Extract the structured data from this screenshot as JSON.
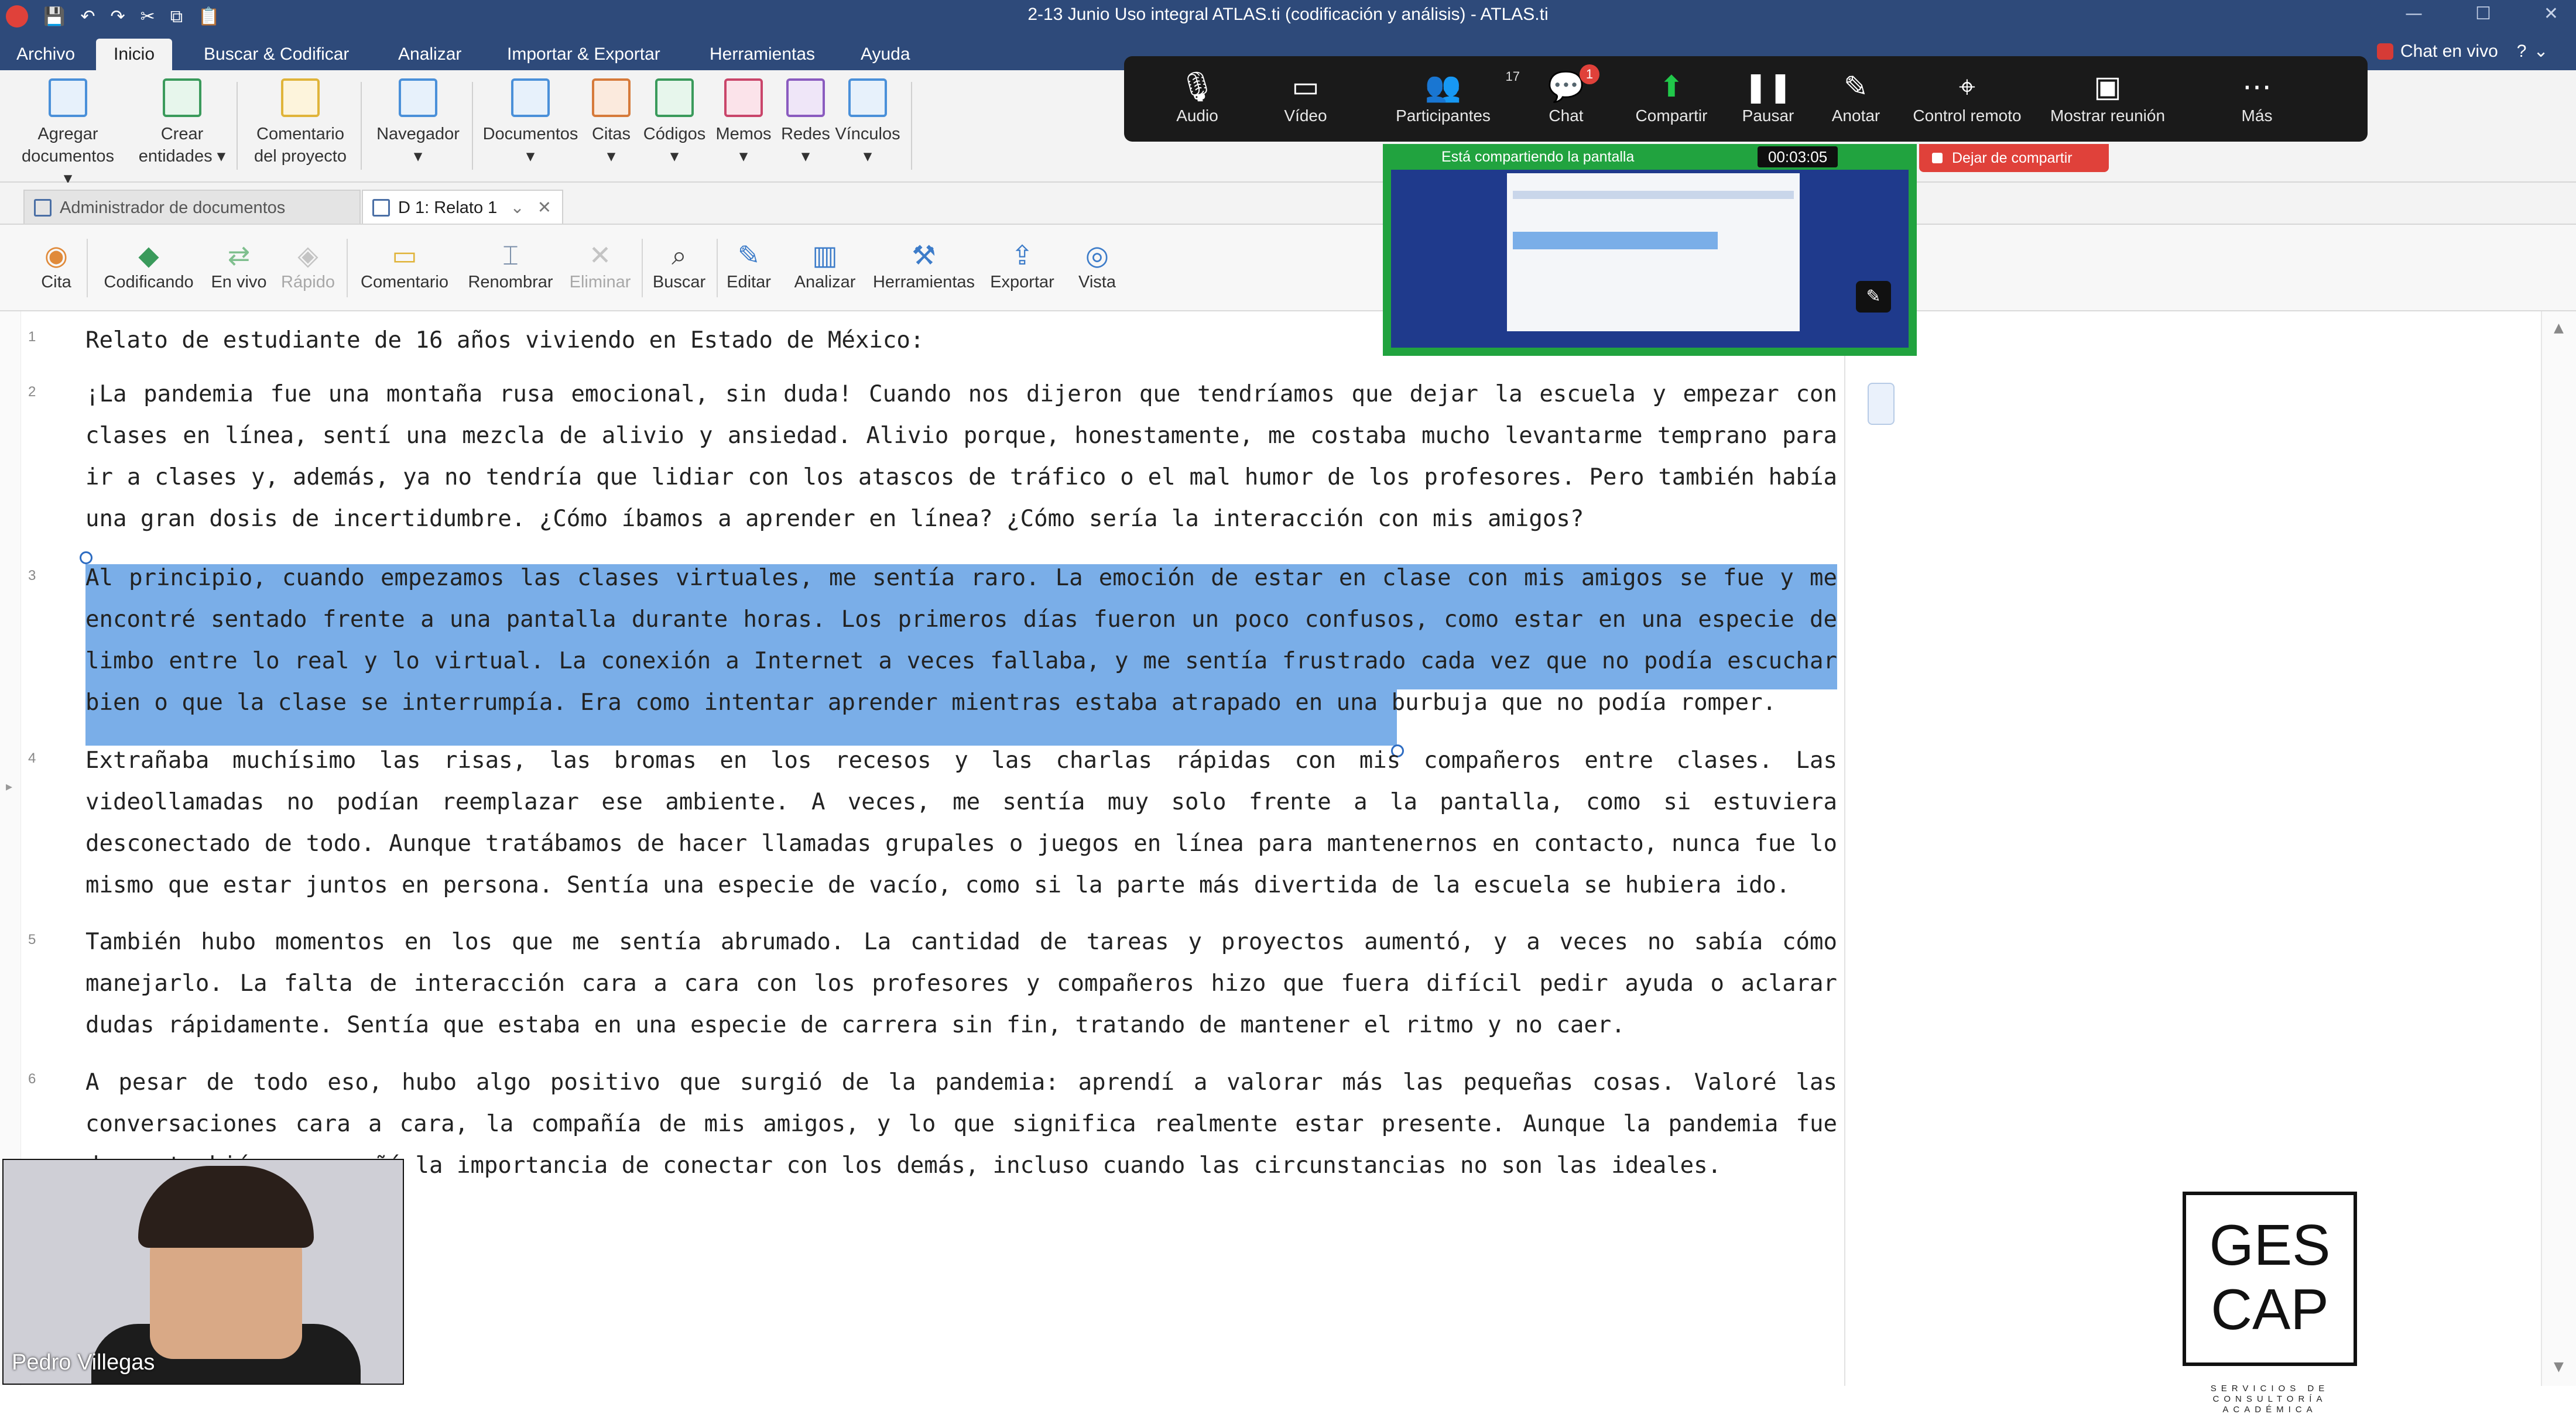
{
  "window": {
    "title": "2-13 Junio Uso integral ATLAS.ti (codificación y análisis) - ATLAS.ti"
  },
  "menu": {
    "tabs": [
      "Archivo",
      "Inicio",
      "Buscar & Codificar",
      "Analizar",
      "Importar & Exportar",
      "Herramientas",
      "Ayuda"
    ],
    "chat_live": "Chat en vivo"
  },
  "ribbon": {
    "buttons": [
      {
        "label1": "Agregar",
        "label2": "documentos ▾"
      },
      {
        "label1": "Crear",
        "label2": "entidades ▾"
      },
      {
        "label1": "Comentario",
        "label2": "del proyecto"
      },
      {
        "label1": "Navegador",
        "label2": "▾"
      },
      {
        "label1": "Documentos",
        "label2": "▾"
      },
      {
        "label1": "Citas",
        "label2": "▾"
      },
      {
        "label1": "Códigos",
        "label2": "▾"
      },
      {
        "label1": "Memos",
        "label2": "▾"
      },
      {
        "label1": "Redes",
        "label2": "▾"
      },
      {
        "label1": "Vínculos",
        "label2": "▾"
      }
    ]
  },
  "doc_tabs": {
    "manager": "Administrador de documentos",
    "active": "D 1: Relato 1"
  },
  "doc_toolbar": {
    "buttons": [
      "Cita",
      "Codificando",
      "En vivo",
      "Rápido",
      "Comentario",
      "Renombrar",
      "Eliminar",
      "Buscar",
      "Editar",
      "Analizar",
      "Herramientas",
      "Exportar",
      "Vista"
    ]
  },
  "zoom": {
    "buttons": [
      "Audio",
      "Vídeo",
      "Participantes",
      "Chat",
      "Compartir",
      "Pausar",
      "Anotar",
      "Control remoto",
      "Mostrar reunión",
      "Más"
    ],
    "participants_count": "17",
    "chat_badge": "1",
    "sharing_text": "Está compartiendo la pantalla",
    "timer": "00:03:05",
    "stop_sharing": "Dejar de compartir"
  },
  "document": {
    "paragraphs": [
      {
        "num": "1",
        "text": "Relato de estudiante de 16 años viviendo en Estado de México:"
      },
      {
        "num": "2",
        "text": "¡La pandemia fue una montaña rusa emocional, sin duda! Cuando nos dijeron que tendríamos que dejar la escuela y empezar con clases en línea, sentí una mezcla de alivio y ansiedad. Alivio porque, honestamente, me costaba mucho levantarme temprano para ir a clases y, además, ya no tendría que lidiar con los atascos de tráfico o el mal humor de los profesores. Pero también había una gran dosis de incertidumbre. ¿Cómo íbamos a aprender en línea? ¿Cómo sería la interacción con mis amigos?"
      },
      {
        "num": "3",
        "text": "Al principio, cuando empezamos las clases virtuales, me sentía raro. La emoción de estar en clase con mis amigos se fue y me encontré sentado frente a una pantalla durante horas. Los primeros días fueron un poco confusos, como estar en una especie de limbo entre lo real y lo virtual. La conexión a Internet a veces fallaba, y me sentía frustrado cada vez que no podía escuchar bien o que la clase se interrumpía. Era como intentar aprender mientras estaba atrapado en una burbuja que no podía romper."
      },
      {
        "num": "4",
        "text": "Extrañaba muchísimo las risas, las bromas en los recesos y las charlas rápidas con mis compañeros entre clases. Las videollamadas no podían reemplazar ese ambiente. A veces, me sentía muy solo frente a la pantalla, como si estuviera desconectado de todo. Aunque tratábamos de hacer llamadas grupales o juegos en línea para mantenernos en contacto, nunca fue lo mismo que estar juntos en persona. Sentía una especie de vacío, como si la parte más divertida de la escuela se hubiera ido."
      },
      {
        "num": "5",
        "text": "También hubo momentos en los que me sentía abrumado. La cantidad de tareas y proyectos aumentó, y a veces no sabía cómo manejarlo. La falta de interacción cara a cara con los profesores y compañeros hizo que fuera difícil pedir ayuda o aclarar dudas rápidamente. Sentía que estaba en una especie de carrera sin fin, tratando de mantener el ritmo y no caer."
      },
      {
        "num": "6",
        "text": "A pesar de todo eso, hubo algo positivo que surgió de la pandemia: aprendí a valorar más las pequeñas cosas. Valoré las conversaciones cara a cara, la compañía de mis amigos, y lo que significa realmente estar presente. Aunque la pandemia fue dura, también me enseñó la importancia de conectar con los demás, incluso cuando las circunstancias no son las ideales."
      }
    ]
  },
  "webcam": {
    "name": "Pedro Villegas"
  },
  "logo": {
    "line1": "GES",
    "line2": "CAP",
    "sub": "SERVICIOS DE CONSULTORÍA ACADÉMICA"
  },
  "colors": {
    "accent": "#2e4a7a",
    "highlight": "#7aaee8",
    "zoom_green": "#21a33f",
    "zoom_red": "#e0413a"
  }
}
